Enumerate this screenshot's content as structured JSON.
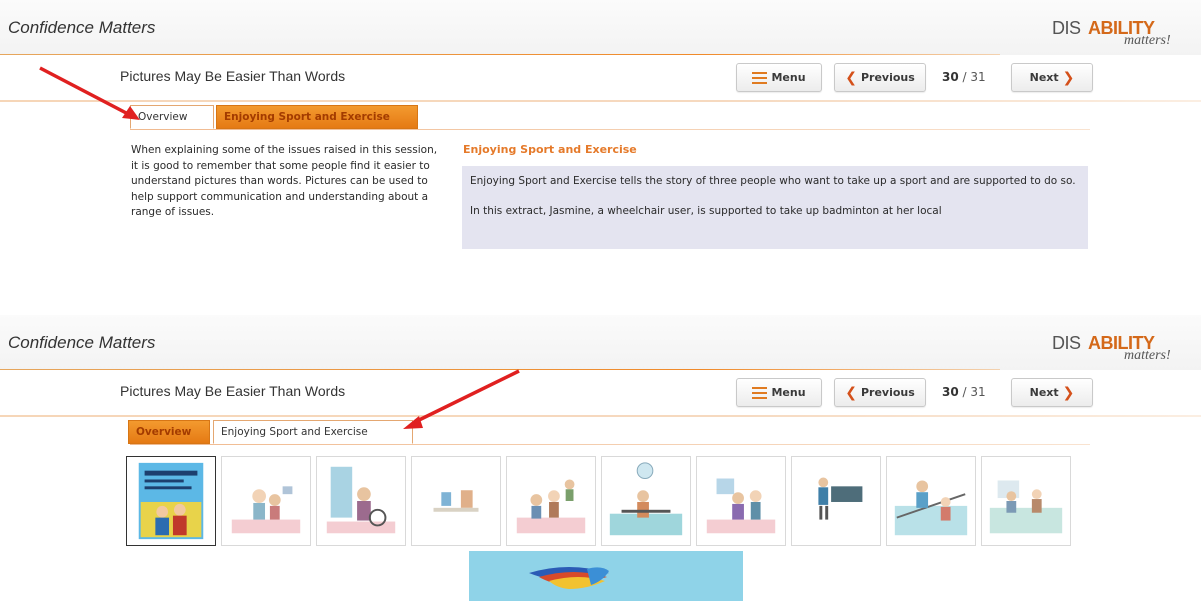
{
  "app": {
    "title": "Confidence Matters",
    "logo": {
      "part1": "DIS",
      "part2": "ABILITY",
      "part3": "matters!"
    },
    "colors": {
      "accent": "#f08a2a",
      "tab_active_border": "#e4a771",
      "content_box": "#e4e4f0",
      "arrow": "#e02020"
    }
  },
  "nav": {
    "page_title": "Pictures May Be Easier Than Words",
    "menu_label": "Menu",
    "menu_icon": "menu-list-icon",
    "previous_label": "Previous",
    "previous_icon": "chevron-left-icon",
    "next_label": "Next",
    "next_icon": "chevron-right-icon",
    "page_current": "30",
    "page_separator": "/",
    "page_total": "31"
  },
  "tabs": [
    {
      "label": "Overview"
    },
    {
      "label": "Enjoying Sport and Exercise"
    }
  ],
  "panel1": {
    "active_tab": "Overview",
    "overview_text": "When explaining some of the issues raised in this session, it is good to remember that some people find it easier to understand pictures than words. Pictures can be used to help support communication and understanding about a range of issues.",
    "section_heading": "Enjoying Sport and Exercise",
    "content_paragraphs": [
      "Enjoying Sport and Exercise tells the story of three people who want to take up a sport and are supported to do so.",
      "In this extract, Jasmine, a wheelchair user, is supported to take up badminton at her local"
    ]
  },
  "panel2": {
    "active_tab": "Enjoying Sport and Exercise",
    "thumbnails": [
      {
        "name": "book-cover-thumbnail",
        "selected": true
      },
      {
        "name": "illustration-thumbnail",
        "selected": false
      },
      {
        "name": "illustration-thumbnail",
        "selected": false
      },
      {
        "name": "illustration-thumbnail",
        "selected": false
      },
      {
        "name": "illustration-thumbnail",
        "selected": false
      },
      {
        "name": "illustration-thumbnail",
        "selected": false
      },
      {
        "name": "illustration-thumbnail",
        "selected": false
      },
      {
        "name": "illustration-thumbnail",
        "selected": false
      },
      {
        "name": "illustration-thumbnail",
        "selected": false
      },
      {
        "name": "illustration-thumbnail",
        "selected": false
      }
    ]
  }
}
